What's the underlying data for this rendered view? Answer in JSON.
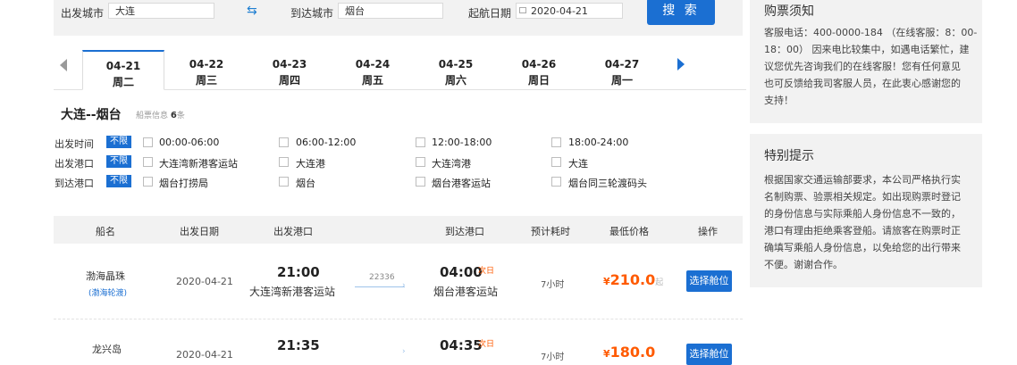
{
  "search": {
    "from_label": "出发城市",
    "from_value": "大连",
    "to_label": "到达城市",
    "to_value": "烟台",
    "date_label": "起航日期",
    "date_value": "2020-04-21",
    "button": "搜 索"
  },
  "tabs": [
    {
      "date": "04-21",
      "week": "周二"
    },
    {
      "date": "04-22",
      "week": "周三"
    },
    {
      "date": "04-23",
      "week": "周四"
    },
    {
      "date": "04-24",
      "week": "周五"
    },
    {
      "date": "04-25",
      "week": "周六"
    },
    {
      "date": "04-26",
      "week": "周日"
    },
    {
      "date": "04-27",
      "week": "周一"
    }
  ],
  "route": {
    "title": "大连--烟台",
    "sub_label": "船票信息",
    "count": "6",
    "count_unit": "条"
  },
  "filters": {
    "no_limit": "不限",
    "rows": [
      {
        "label": "出发时间",
        "options": [
          "00:00-06:00",
          "06:00-12:00",
          "12:00-18:00",
          "18:00-24:00"
        ]
      },
      {
        "label": "出发港口",
        "options": [
          "大连湾新港客运站",
          "大连港",
          "大连湾港",
          "大连"
        ]
      },
      {
        "label": "到达港口",
        "options": [
          "烟台打捞局",
          "烟台",
          "烟台港客运站",
          "烟台同三轮渡码头"
        ]
      }
    ]
  },
  "table": {
    "headers": [
      "船名",
      "出发日期",
      "出发港口",
      "到达港口",
      "预计耗时",
      "最低价格",
      "操作"
    ],
    "rows": [
      {
        "ship": "渤海晶珠",
        "company": "(渤海轮渡)",
        "date": "2020-04-21",
        "dep_time": "21:00",
        "dep_port": "大连湾新港客运站",
        "voyage": "22336",
        "arr_time": "04:00",
        "next_day": "次日",
        "arr_port": "烟台港客运站",
        "duration": "7小时",
        "currency": "¥",
        "price": "210.0",
        "price_suffix": "起",
        "action": "选择舱位"
      },
      {
        "ship": "龙兴岛",
        "date": "2020-04-21",
        "dep_time": "21:35",
        "arr_time": "04:35",
        "next_day": "次日",
        "duration": "7小时",
        "currency": "¥",
        "price": "180.0",
        "action": "选择舱位"
      }
    ]
  },
  "sidebar": {
    "notice_title": "购票须知",
    "notice_lines": [
      "客服电话：400-0000-184 （在线客服：8：00-",
      "18：00） 因来电比较集中，如遇电话繁忙，建",
      "议您优先咨询我们的在线客服！您有任何意见",
      "也可反馈给我司客服人员，在此衷心感谢您的",
      "支持！"
    ],
    "tips_title": "特别提示",
    "tips_lines": [
      "根据国家交通运输部要求，本公司严格执行实",
      "名制购票、验票相关规定。如出现购票时登记",
      "的身份信息与实际乘船人身份信息不一致的，",
      "港口有理由拒绝乘客登船。请旅客在购票时正",
      "确填写乘船人身份信息，以免给您的出行带来",
      "不便。谢谢合作。"
    ]
  }
}
